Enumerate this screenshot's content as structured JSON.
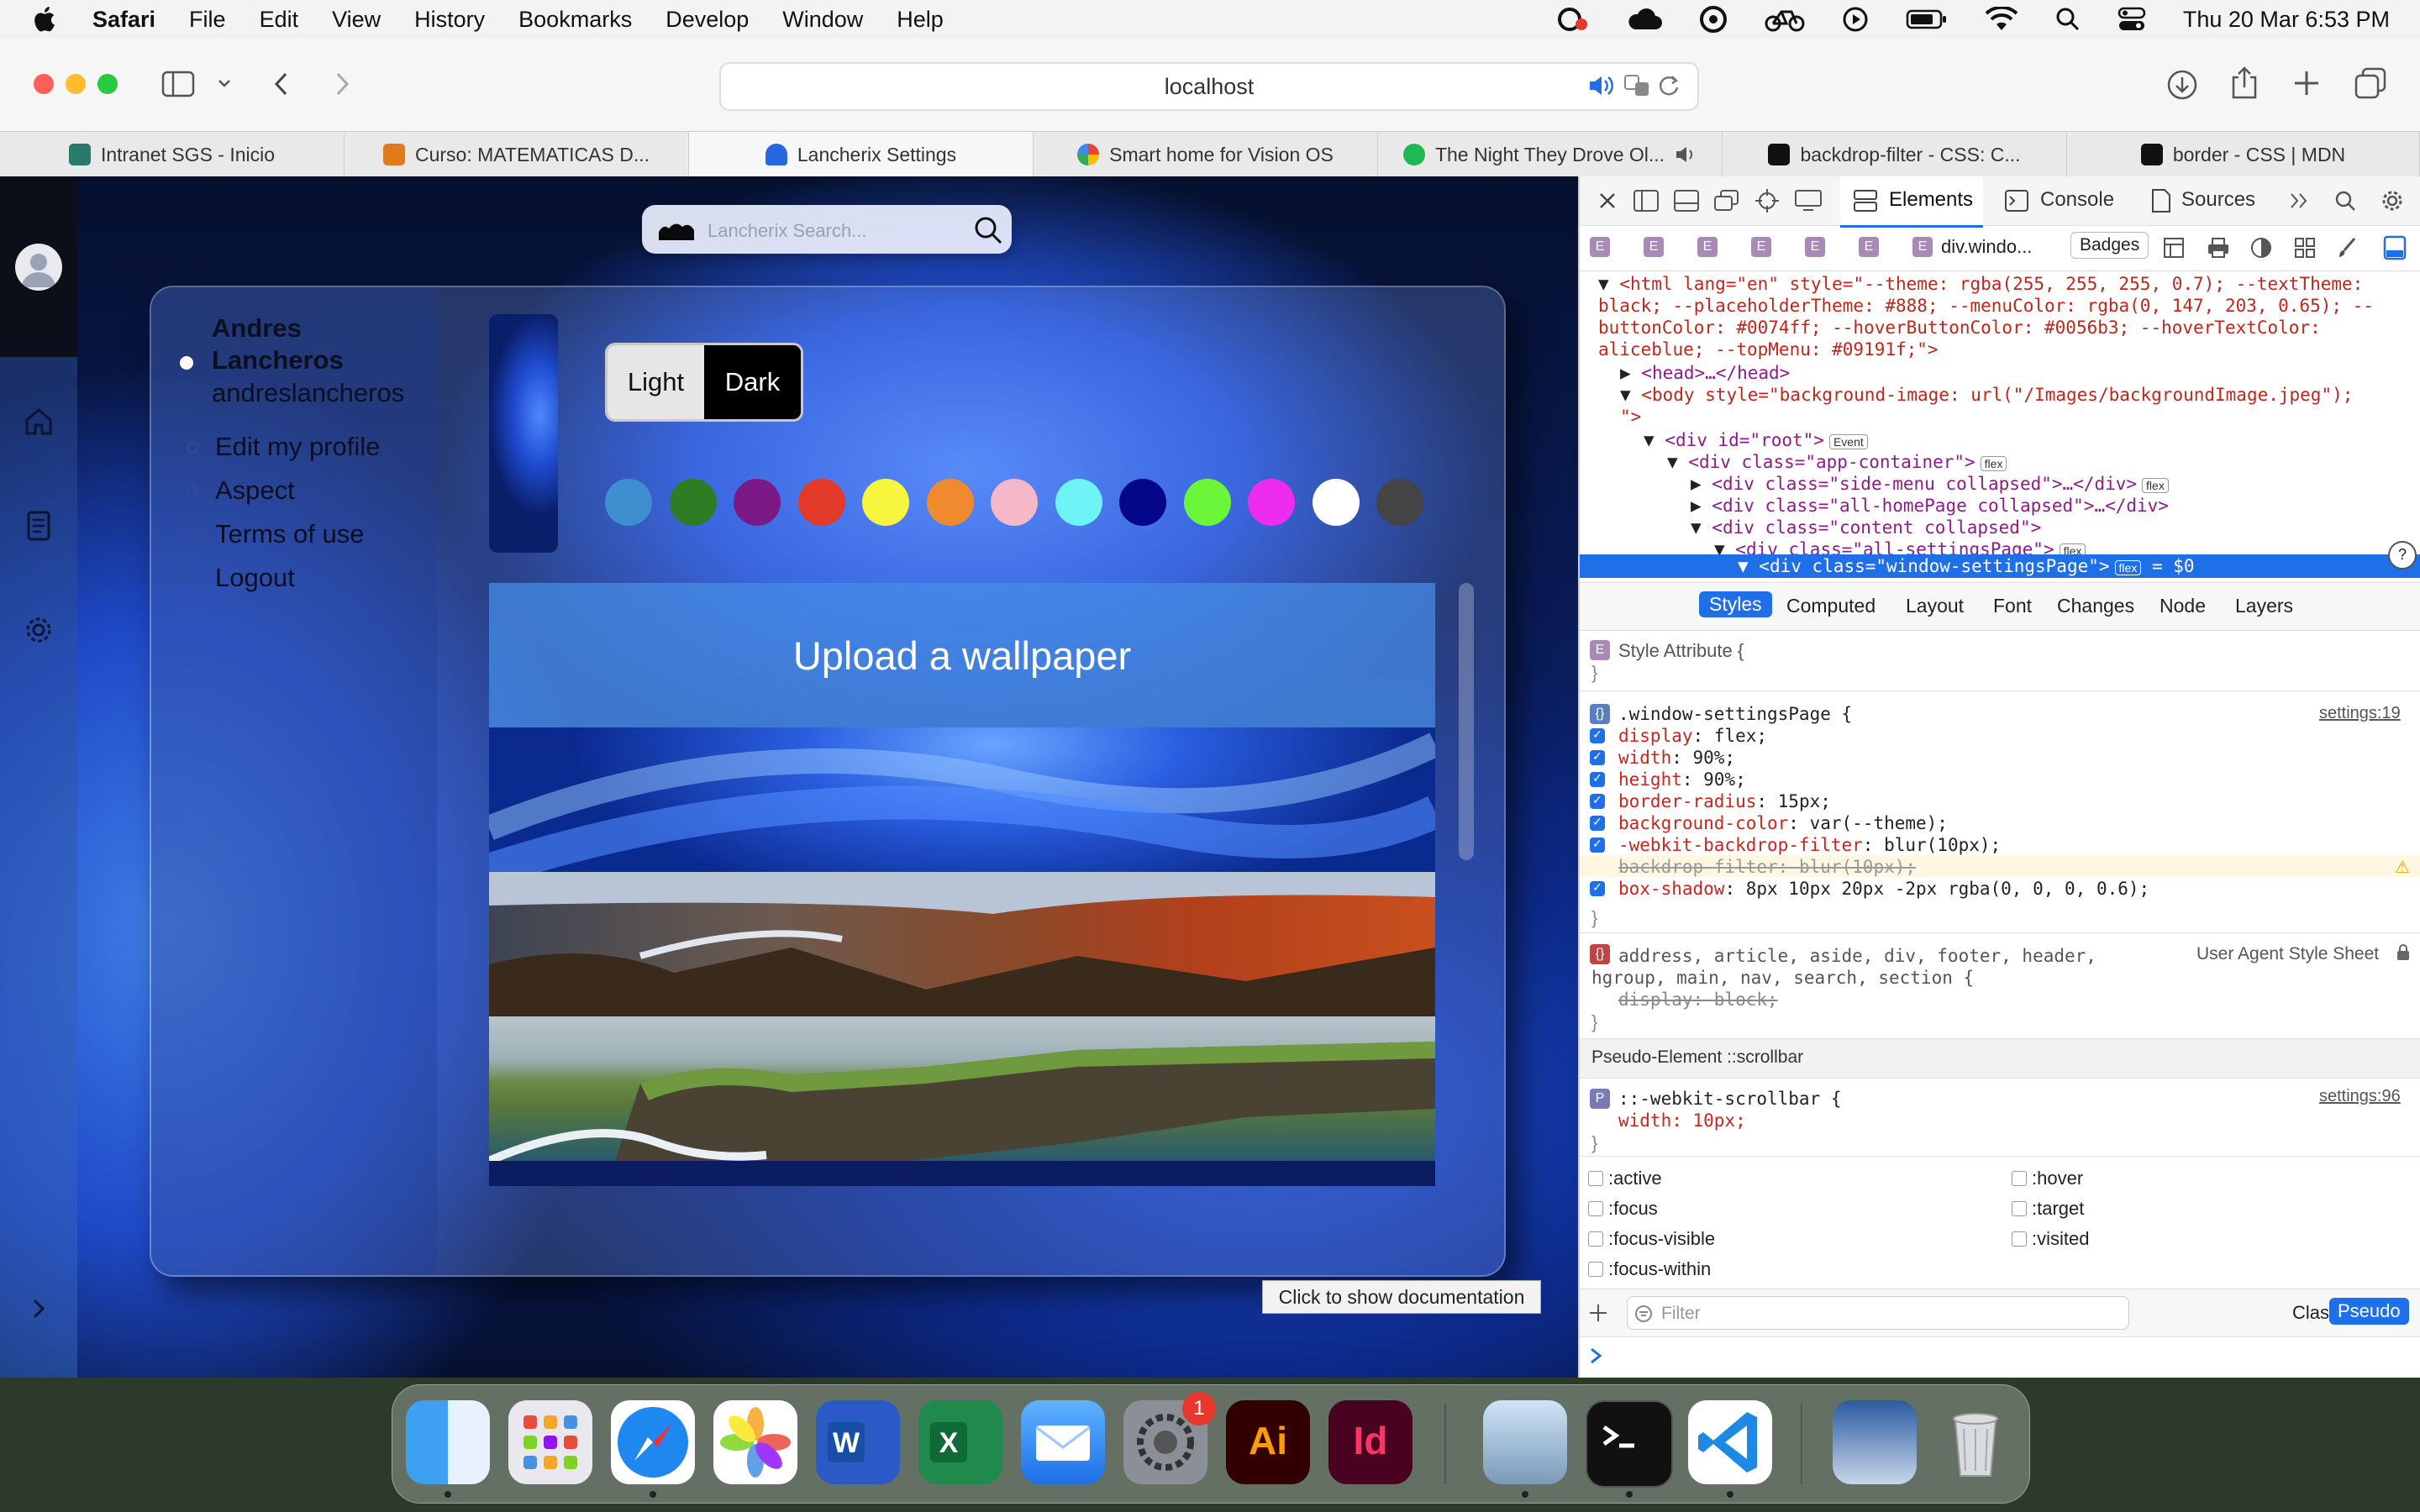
{
  "menubar": {
    "app": "Safari",
    "items": [
      "File",
      "Edit",
      "View",
      "History",
      "Bookmarks",
      "Develop",
      "Window",
      "Help"
    ],
    "clock": "Thu 20 Mar  6:53 PM"
  },
  "toolbar": {
    "address": "localhost"
  },
  "tabs": [
    {
      "label": "Intranet SGS - Inicio",
      "color": "#2a7a6a"
    },
    {
      "label": "Curso: MATEMATICAS D...",
      "color": "#e07a1a"
    },
    {
      "label": "Lancherix Settings",
      "color": "#2a66e0"
    },
    {
      "label": "Smart home for Vision OS",
      "color": "#4285f4"
    },
    {
      "label": "The Night They Drove Ol...",
      "color": "#1db954"
    },
    {
      "label": "backdrop-filter - CSS: C...",
      "color": "#111111"
    },
    {
      "label": "border - CSS | MDN",
      "color": "#111111"
    }
  ],
  "page": {
    "search_placeholder": "Lancherix Search...",
    "user": {
      "name": "Andres Lancheros",
      "handle": "andreslancheros"
    },
    "menu": [
      "Edit my profile",
      "Aspect",
      "Terms of use",
      "Logout"
    ],
    "theme": {
      "light": "Light",
      "dark": "Dark",
      "selected": "Dark"
    },
    "swatches": [
      "#3e8ed0",
      "#2e7d25",
      "#7b1a86",
      "#e43a2a",
      "#f7f53e",
      "#f08a2f",
      "#f4b8c8",
      "#6ef3f6",
      "#05078a",
      "#6cf63a",
      "#ee2cf0",
      "#ffffff",
      "#444444"
    ],
    "upload_label": "Upload a wallpaper",
    "tooltip": "Click to show documentation"
  },
  "devtools": {
    "tabs": [
      "Elements",
      "Console",
      "Sources"
    ],
    "breadcrumb_last": "div.windo...",
    "badges_label": "Badges",
    "dom": {
      "html_open": "<html lang=\"en\" style=\"--theme: rgba(255, 255, 255, 0.7); --textTheme:",
      "html_2": "black; --placeholderTheme: #888; --menuColor: rgba(0, 147, 203, 0.65); --",
      "html_3": "buttonColor: #0074ff; --hoverButtonColor: #0056b3; --hoverTextColor:",
      "html_4": "aliceblue; --topMenu: #09191f;\">",
      "head": "<head>…</head>",
      "body": "<body style=\"background-image: url(\"/Images/backgroundImage.jpeg\");",
      "body_end": "\">",
      "root": "<div id=\"root\">",
      "root_pill": "Event",
      "app": "<div class=\"app-container\">",
      "side": "<div class=\"side-menu collapsed\">…</div>",
      "home": "<div class=\"all-homePage collapsed\">…</div>",
      "content": "<div class=\"content collapsed\">",
      "settings": "<div class=\"all-settingsPage\">",
      "window": "<div class=\"window-settingsPage\">",
      "flex_pill": "flex",
      "eq": "= $0"
    },
    "subtabs": [
      "Styles",
      "Computed",
      "Layout",
      "Font",
      "Changes",
      "Node",
      "Layers"
    ],
    "style_attr": "Style Attribute {",
    "selector": ".window-settingsPage {",
    "selector_src": "settings:19",
    "props": [
      {
        "name": "display",
        "value": "flex;"
      },
      {
        "name": "width",
        "value": "90%;"
      },
      {
        "name": "height",
        "value": "90%;"
      },
      {
        "name": "border-radius",
        "value": "15px;"
      },
      {
        "name": "background-color",
        "value": "var(--theme);"
      },
      {
        "name": "-webkit-backdrop-filter",
        "value": "blur(10px);"
      },
      {
        "name": "backdrop-filter",
        "value": "blur(10px);"
      },
      {
        "name": "box-shadow",
        "value": "8px 10px 20px -2px rgba(0, 0, 0, 0.6);"
      }
    ],
    "ua_selector_1": "address, article, aside, div, footer, header,",
    "ua_selector_2": "hgroup, main, nav, search, section {",
    "ua_prop": "display: block;",
    "ua_label": "User Agent Style Sheet",
    "pseudo_header": "Pseudo-Element ::scrollbar",
    "scrollbar_selector": "::-webkit-scrollbar {",
    "scrollbar_src": "settings:96",
    "scrollbar_prop": "width: 10px;",
    "pseudo_classes": [
      ":active",
      ":hover",
      ":focus",
      ":target",
      ":focus-visible",
      ":visited",
      ":focus-within"
    ],
    "filter_placeholder": "Filter",
    "classes_label": "Classes",
    "pseudo_label": "Pseudo"
  },
  "dock": {
    "badge": "1",
    "apps": [
      "Finder",
      "Launchpad",
      "Safari",
      "Photos",
      "Word",
      "Excel",
      "Mail",
      "System Settings",
      "Illustrator",
      "InDesign",
      "Preview",
      "Terminal",
      "Visual Studio Code",
      "Documents",
      "Trash"
    ]
  }
}
